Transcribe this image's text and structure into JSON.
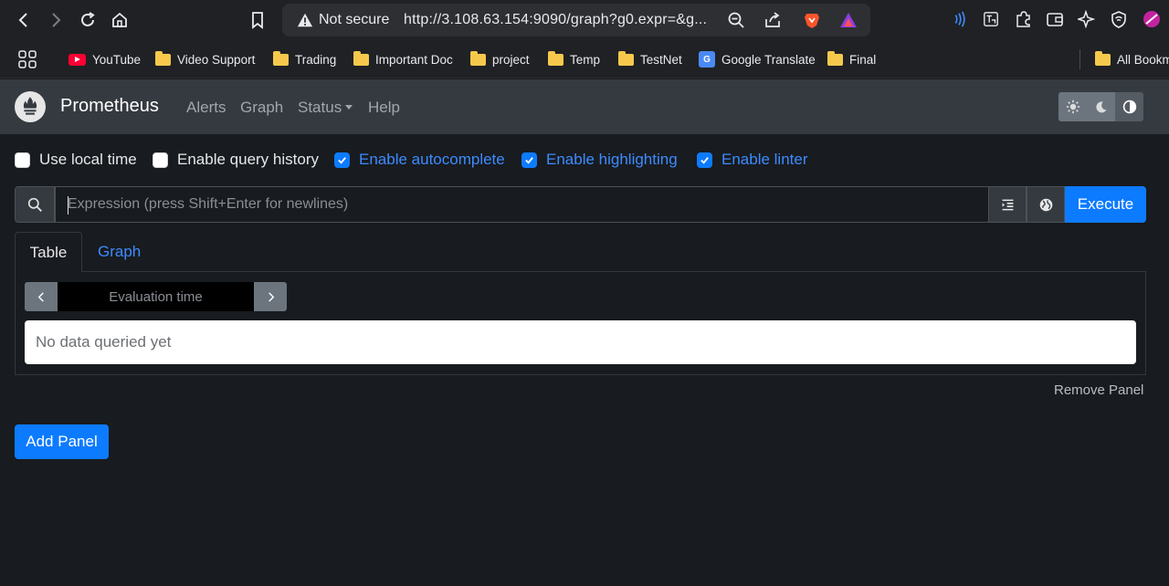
{
  "browser": {
    "security_label": "Not secure",
    "url": "http://3.108.63.154:9090/graph?g0.expr=&g...",
    "bookmarks": [
      {
        "label": "YouTube",
        "icon": "youtube-icon"
      },
      {
        "label": "Video Support",
        "icon": "folder-icon"
      },
      {
        "label": "Trading",
        "icon": "folder-icon"
      },
      {
        "label": "Important Doc",
        "icon": "folder-icon"
      },
      {
        "label": "project",
        "icon": "folder-icon"
      },
      {
        "label": "Temp",
        "icon": "folder-icon"
      },
      {
        "label": "TestNet",
        "icon": "folder-icon"
      },
      {
        "label": "Google Translate",
        "icon": "google-translate-icon"
      },
      {
        "label": "Final",
        "icon": "folder-icon"
      }
    ],
    "all_bookmarks_label": "All Bookm"
  },
  "navbar": {
    "brand": "Prometheus",
    "links": [
      "Alerts",
      "Graph",
      "Status",
      "Help"
    ]
  },
  "options": [
    {
      "label": "Use local time",
      "checked": false
    },
    {
      "label": "Enable query history",
      "checked": false
    },
    {
      "label": "Enable autocomplete",
      "checked": true
    },
    {
      "label": "Enable highlighting",
      "checked": true
    },
    {
      "label": "Enable linter",
      "checked": true
    }
  ],
  "expression": {
    "placeholder": "Expression (press Shift+Enter for newlines)",
    "execute_label": "Execute"
  },
  "tabs": {
    "table": "Table",
    "graph": "Graph"
  },
  "panel": {
    "evaluation_placeholder": "Evaluation time",
    "no_data": "No data queried yet",
    "remove_label": "Remove Panel"
  },
  "add_panel_label": "Add Panel",
  "colors": {
    "accent": "#0d7bff",
    "background": "#181b1f",
    "navbar": "#343a40"
  }
}
